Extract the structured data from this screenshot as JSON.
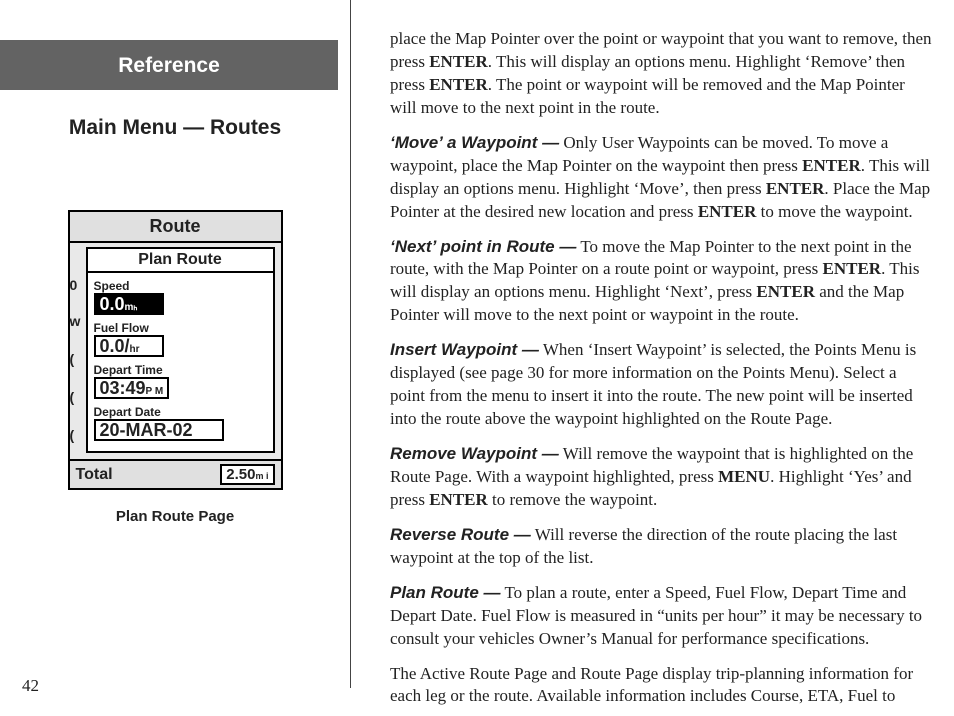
{
  "sidebar": {
    "tab": "Reference",
    "title": "Main Menu — Routes"
  },
  "device": {
    "header": "Route",
    "subheader": "Plan Route",
    "side0": "0",
    "sideW": "w",
    "speed_label": "Speed",
    "speed_value": "0.0",
    "speed_unit": "mₕ",
    "fuel_label": "Fuel Flow",
    "fuel_value": "0.0/",
    "fuel_unit": "hr",
    "time_label": "Depart Time",
    "time_value": "03:49",
    "time_unit": "P M",
    "date_label": "Depart Date",
    "date_value": "20-MAR-02",
    "footer_label": "Total",
    "footer_value": "2.50",
    "footer_unit": "m i"
  },
  "caption": "Plan Route Page",
  "pagenum": "42",
  "paras": {
    "p0a": "place the Map Pointer over the point or waypoint that you want to remove, then press ",
    "p0b": ".  This will display an options menu.  Highlight ‘Remove’ then press ",
    "p0c": ".  The point or waypoint will be removed and the Map Pointer will move to the next point in the route.",
    "k1": "‘Move’ a Waypoint —",
    "p1a": " Only User Waypoints can be moved.  To move a waypoint, place the Map Pointer on the waypoint then press ",
    "p1b": ".  This will display an options menu. Highlight ‘Move’, then press ",
    "p1c": ".  Place the Map Pointer at the desired new location and press ",
    "p1d": " to move the waypoint.",
    "k2": "‘Next’ point in Route —",
    "p2a": " To move the Map Pointer to the next point in the route, with the Map Pointer on a route point or waypoint, press ",
    "p2b": ". This will display an options menu.  Highlight ‘Next’, press ",
    "p2c": " and the Map Pointer will move to the next point or waypoint in the route.",
    "k3": "Insert Waypoint —",
    "p3": " When ‘Insert Waypoint’ is selected, the Points Menu is displayed (see page 30 for more information on the Points Menu). Select a point from the menu to insert it into the route. The new point will be inserted into the route above the waypoint highlighted on the Route Page.",
    "k4": "Remove Waypoint —",
    "p4a": " Will remove the waypoint that is highlighted on the Route Page. With a waypoint highlighted, press ",
    "p4b": ".  Highlight ‘Yes’ and press ",
    "p4c": " to remove the waypoint.",
    "k5": "Reverse Route —",
    "p5": "  Will reverse the direction of the route placing the last waypoint at the top of the list.",
    "k6": "Plan Route —",
    "p6": " To plan a route, enter a Speed, Fuel Flow, Depart Time and Depart Date. Fuel Flow is measured in “units per hour” it may be necessary to consult your vehicles Owner’s Manual for performance specifications.",
    "p7": "The Active Route Page and Route Page display trip-planning information for each leg or the route.  Available information includes Course, ETA, Fuel to",
    "ENTER": "ENTER",
    "MENU": "MENU"
  }
}
